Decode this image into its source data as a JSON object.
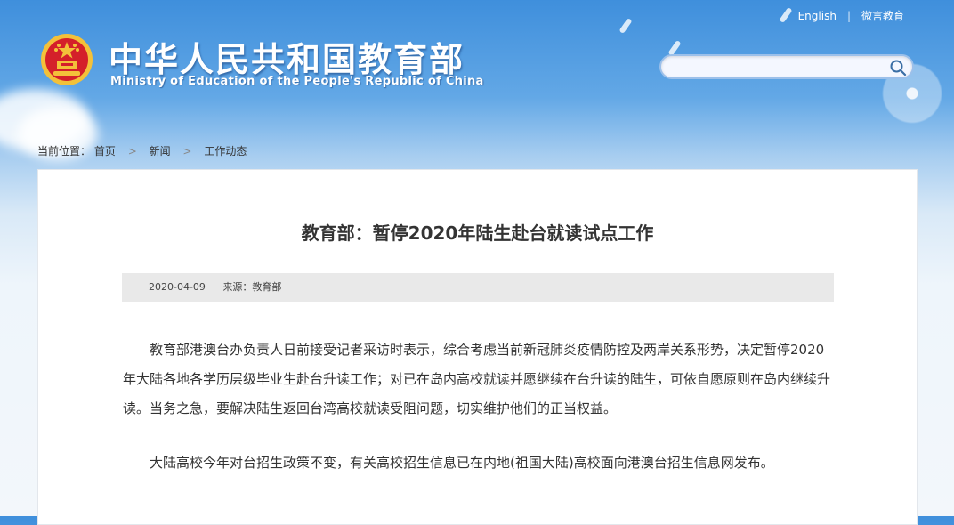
{
  "header": {
    "title_cn": "中华人民共和国教育部",
    "title_en": "Ministry of Education of the People's Republic of China"
  },
  "topbar": {
    "english_link": "English",
    "separator": "|",
    "wechat_link": "微言教育"
  },
  "search": {
    "value": "",
    "placeholder": ""
  },
  "breadcrumb": {
    "label": "当前位置：",
    "items": [
      "首页",
      "新闻",
      "工作动态"
    ]
  },
  "article": {
    "title": "教育部：暂停2020年陆生赴台就读试点工作",
    "date": "2020-04-09",
    "source": "来源：教育部",
    "paragraphs": [
      "教育部港澳台办负责人日前接受记者采访时表示，综合考虑当前新冠肺炎疫情防控及两岸关系形势，决定暂停2020年大陆各地各学历层级毕业生赴台升读工作；对已在岛内高校就读并愿继续在台升读的陆生，可依自愿原则在岛内继续升读。当务之急，要解决陆生返回台湾高校就读受阻问题，切实维护他们的正当权益。",
      "大陆高校今年对台招生政策不变，有关高校招生信息已在内地(祖国大陆)高校面向港澳台招生信息网发布。"
    ]
  },
  "icons": {
    "emblem": "national-emblem-icon",
    "search": "search-icon",
    "breadcrumb_arrow": "chevron-right-icon"
  },
  "colors": {
    "sky_top": "#3f8fdc",
    "emblem_red": "#d4202a",
    "emblem_gold": "#f3c13a",
    "meta_bar": "#e9e9e9"
  }
}
